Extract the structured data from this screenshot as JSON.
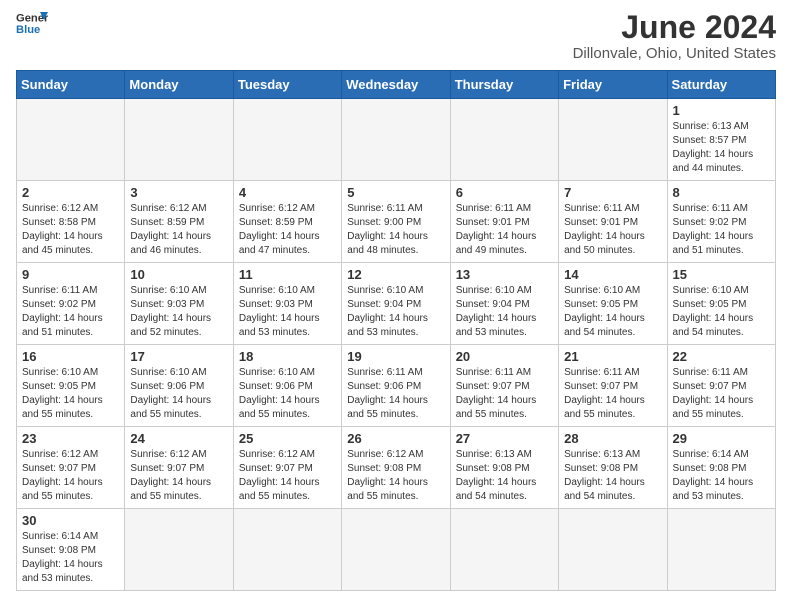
{
  "header": {
    "logo_general": "General",
    "logo_blue": "Blue",
    "month_title": "June 2024",
    "location": "Dillonvale, Ohio, United States"
  },
  "days_of_week": [
    "Sunday",
    "Monday",
    "Tuesday",
    "Wednesday",
    "Thursday",
    "Friday",
    "Saturday"
  ],
  "weeks": [
    [
      {
        "day": "",
        "info": ""
      },
      {
        "day": "",
        "info": ""
      },
      {
        "day": "",
        "info": ""
      },
      {
        "day": "",
        "info": ""
      },
      {
        "day": "",
        "info": ""
      },
      {
        "day": "",
        "info": ""
      },
      {
        "day": "1",
        "info": "Sunrise: 6:13 AM\nSunset: 8:57 PM\nDaylight: 14 hours\nand 44 minutes."
      }
    ],
    [
      {
        "day": "2",
        "info": "Sunrise: 6:12 AM\nSunset: 8:58 PM\nDaylight: 14 hours\nand 45 minutes."
      },
      {
        "day": "3",
        "info": "Sunrise: 6:12 AM\nSunset: 8:59 PM\nDaylight: 14 hours\nand 46 minutes."
      },
      {
        "day": "4",
        "info": "Sunrise: 6:12 AM\nSunset: 8:59 PM\nDaylight: 14 hours\nand 47 minutes."
      },
      {
        "day": "5",
        "info": "Sunrise: 6:11 AM\nSunset: 9:00 PM\nDaylight: 14 hours\nand 48 minutes."
      },
      {
        "day": "6",
        "info": "Sunrise: 6:11 AM\nSunset: 9:01 PM\nDaylight: 14 hours\nand 49 minutes."
      },
      {
        "day": "7",
        "info": "Sunrise: 6:11 AM\nSunset: 9:01 PM\nDaylight: 14 hours\nand 50 minutes."
      },
      {
        "day": "8",
        "info": "Sunrise: 6:11 AM\nSunset: 9:02 PM\nDaylight: 14 hours\nand 51 minutes."
      }
    ],
    [
      {
        "day": "9",
        "info": "Sunrise: 6:11 AM\nSunset: 9:02 PM\nDaylight: 14 hours\nand 51 minutes."
      },
      {
        "day": "10",
        "info": "Sunrise: 6:10 AM\nSunset: 9:03 PM\nDaylight: 14 hours\nand 52 minutes."
      },
      {
        "day": "11",
        "info": "Sunrise: 6:10 AM\nSunset: 9:03 PM\nDaylight: 14 hours\nand 53 minutes."
      },
      {
        "day": "12",
        "info": "Sunrise: 6:10 AM\nSunset: 9:04 PM\nDaylight: 14 hours\nand 53 minutes."
      },
      {
        "day": "13",
        "info": "Sunrise: 6:10 AM\nSunset: 9:04 PM\nDaylight: 14 hours\nand 53 minutes."
      },
      {
        "day": "14",
        "info": "Sunrise: 6:10 AM\nSunset: 9:05 PM\nDaylight: 14 hours\nand 54 minutes."
      },
      {
        "day": "15",
        "info": "Sunrise: 6:10 AM\nSunset: 9:05 PM\nDaylight: 14 hours\nand 54 minutes."
      }
    ],
    [
      {
        "day": "16",
        "info": "Sunrise: 6:10 AM\nSunset: 9:05 PM\nDaylight: 14 hours\nand 55 minutes."
      },
      {
        "day": "17",
        "info": "Sunrise: 6:10 AM\nSunset: 9:06 PM\nDaylight: 14 hours\nand 55 minutes."
      },
      {
        "day": "18",
        "info": "Sunrise: 6:10 AM\nSunset: 9:06 PM\nDaylight: 14 hours\nand 55 minutes."
      },
      {
        "day": "19",
        "info": "Sunrise: 6:11 AM\nSunset: 9:06 PM\nDaylight: 14 hours\nand 55 minutes."
      },
      {
        "day": "20",
        "info": "Sunrise: 6:11 AM\nSunset: 9:07 PM\nDaylight: 14 hours\nand 55 minutes."
      },
      {
        "day": "21",
        "info": "Sunrise: 6:11 AM\nSunset: 9:07 PM\nDaylight: 14 hours\nand 55 minutes."
      },
      {
        "day": "22",
        "info": "Sunrise: 6:11 AM\nSunset: 9:07 PM\nDaylight: 14 hours\nand 55 minutes."
      }
    ],
    [
      {
        "day": "23",
        "info": "Sunrise: 6:12 AM\nSunset: 9:07 PM\nDaylight: 14 hours\nand 55 minutes."
      },
      {
        "day": "24",
        "info": "Sunrise: 6:12 AM\nSunset: 9:07 PM\nDaylight: 14 hours\nand 55 minutes."
      },
      {
        "day": "25",
        "info": "Sunrise: 6:12 AM\nSunset: 9:07 PM\nDaylight: 14 hours\nand 55 minutes."
      },
      {
        "day": "26",
        "info": "Sunrise: 6:12 AM\nSunset: 9:08 PM\nDaylight: 14 hours\nand 55 minutes."
      },
      {
        "day": "27",
        "info": "Sunrise: 6:13 AM\nSunset: 9:08 PM\nDaylight: 14 hours\nand 54 minutes."
      },
      {
        "day": "28",
        "info": "Sunrise: 6:13 AM\nSunset: 9:08 PM\nDaylight: 14 hours\nand 54 minutes."
      },
      {
        "day": "29",
        "info": "Sunrise: 6:14 AM\nSunset: 9:08 PM\nDaylight: 14 hours\nand 53 minutes."
      }
    ],
    [
      {
        "day": "30",
        "info": "Sunrise: 6:14 AM\nSunset: 9:08 PM\nDaylight: 14 hours\nand 53 minutes."
      },
      {
        "day": "",
        "info": ""
      },
      {
        "day": "",
        "info": ""
      },
      {
        "day": "",
        "info": ""
      },
      {
        "day": "",
        "info": ""
      },
      {
        "day": "",
        "info": ""
      },
      {
        "day": "",
        "info": ""
      }
    ]
  ]
}
